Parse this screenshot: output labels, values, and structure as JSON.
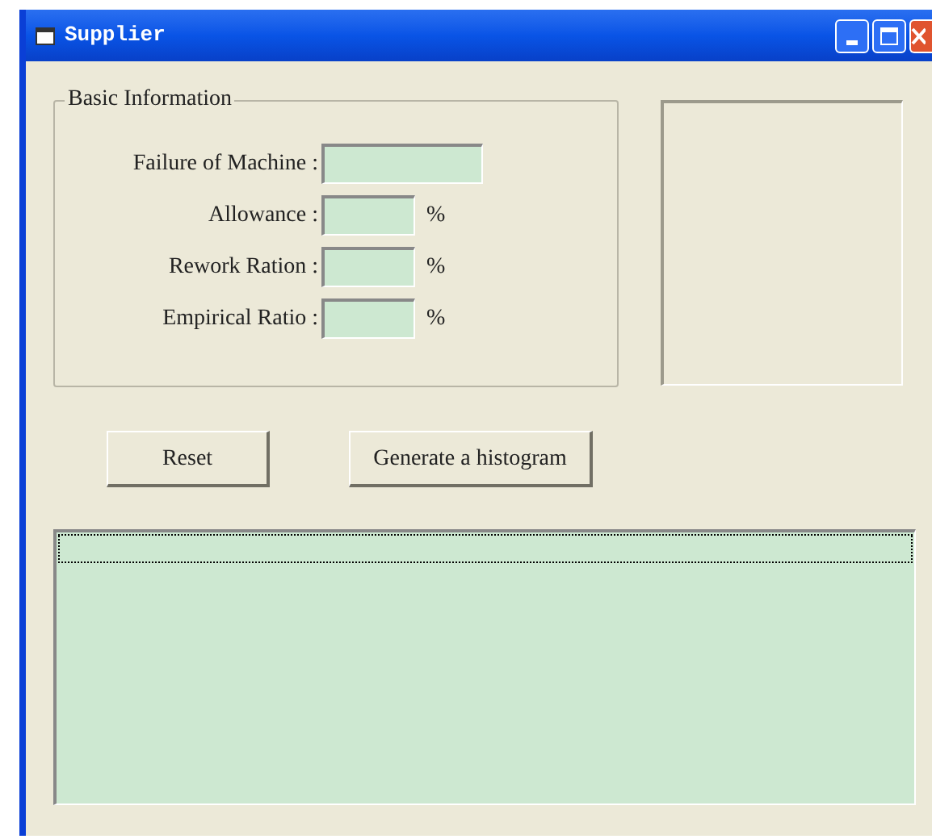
{
  "window": {
    "title": "Supplier"
  },
  "basic_information": {
    "title": "Basic Information",
    "fields": [
      {
        "label": "Failure of Machine :",
        "kind": "wide"
      },
      {
        "label": "Allowance :",
        "kind": "percent",
        "unit": "%"
      },
      {
        "label": "Rework Ration :",
        "kind": "percent",
        "unit": "%"
      },
      {
        "label": "Empirical Ratio :",
        "kind": "percent",
        "unit": "%"
      }
    ]
  },
  "buttons": [
    "Reset",
    "Generate a histogram"
  ],
  "list": {
    "focused_row": true
  }
}
